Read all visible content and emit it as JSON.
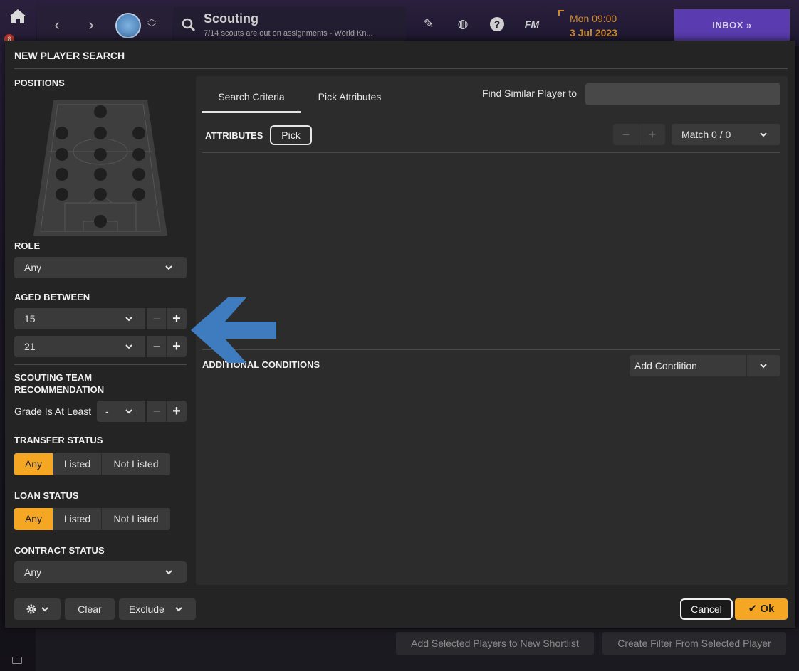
{
  "topbar": {
    "page_title": "Scouting",
    "page_subtitle": "7/14 scouts are out on assignments - World Kn...",
    "rail_badge": "8",
    "date_time": "Mon 09:00",
    "date_date": "3 Jul 2023",
    "fm_label": "FM",
    "inbox_label": "INBOX »"
  },
  "background": {
    "add_shortlist_label": "Add Selected Players to New Shortlist",
    "create_filter_label": "Create Filter From Selected Player"
  },
  "dialog": {
    "title": "NEW PLAYER SEARCH",
    "positions_label": "POSITIONS",
    "role_label": "ROLE",
    "role_value": "Any",
    "aged_label": "AGED BETWEEN",
    "age_min": "15",
    "age_max": "21",
    "stepper_minus": "−",
    "stepper_plus": "+",
    "scouting_label_1": "SCOUTING TEAM",
    "scouting_label_2": "RECOMMENDATION",
    "grade_label": "Grade Is At Least",
    "grade_value": "-",
    "transfer_label": "TRANSFER STATUS",
    "transfer_options": [
      "Any",
      "Listed",
      "Not Listed"
    ],
    "loan_label": "LOAN STATUS",
    "loan_options": [
      "Any",
      "Listed",
      "Not Listed"
    ],
    "contract_label": "CONTRACT STATUS",
    "contract_value": "Any",
    "tabs": [
      "Search Criteria",
      "Pick Attributes"
    ],
    "find_similar_label": "Find Similar Player to",
    "find_similar_value": "",
    "attributes_label": "ATTRIBUTES",
    "pick_label": "Pick",
    "match_label": "Match 0 / 0",
    "additional_label": "ADDITIONAL CONDITIONS",
    "add_condition_label": "Add Condition",
    "clear_label": "Clear",
    "exclude_label": "Exclude",
    "cancel_label": "Cancel",
    "ok_label": "✔ Ok"
  },
  "colors": {
    "accent": "#f5a623",
    "inbox": "#5a3cb0",
    "date": "#d08a2c",
    "annotation_arrow": "#3f7bbf"
  }
}
